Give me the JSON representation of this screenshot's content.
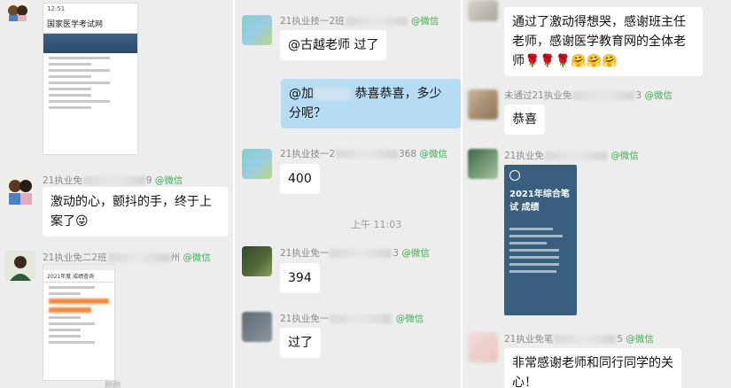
{
  "left": {
    "msg1": {
      "sender_prefix": "21执业免",
      "sender_suffix": "9",
      "source": "@微信",
      "text": "激动的心，颤抖的手，终于上案了",
      "emoji": "😜"
    },
    "msg2": {
      "sender_prefix": "21执业免二2班",
      "sender_suffix": "州",
      "source": "@微信"
    },
    "top_image_title": "国家医学考试网",
    "mini_time": "12:51",
    "shot2_title": "2021年度 成绩查询",
    "bottom_caption": "刚刚"
  },
  "center": {
    "msg1": {
      "sender_prefix": "21执业技一2班",
      "sender_suffix": "",
      "source": "@微信",
      "text": "@古越老师 过了"
    },
    "msg2": {
      "at": "@加",
      "text": "恭喜恭喜，多少分呢？"
    },
    "msg3": {
      "sender_prefix": "21执业技一2",
      "sender_suffix": "368",
      "source": "@微信",
      "text": "400"
    },
    "time": "上午 11:03",
    "msg4": {
      "sender_prefix": "21执业免一",
      "sender_suffix": "3",
      "source": "@微信",
      "text": "394"
    },
    "msg5": {
      "sender_prefix": "21执业免一",
      "sender_suffix": "",
      "source": "@微信",
      "text": "过了"
    }
  },
  "right": {
    "msg0": {
      "text": "通过了激动得想哭，感谢班主任老师，感谢医学教育网的全体老师",
      "emoji": "🌹🌹🌹🤗🤗🤗"
    },
    "msg1": {
      "sender_prefix": "未通过21执业免",
      "sender_suffix": "3",
      "source": "@微信",
      "text": "恭喜"
    },
    "msg2": {
      "sender_prefix": "21执业免",
      "sender_suffix": "",
      "source": "@微信",
      "card_title": "2021年综合笔试 成绩"
    },
    "msg3": {
      "sender_prefix": "21执业免笔",
      "sender_suffix": "5",
      "source": "@微信",
      "text": "非常感谢老师和同行同学的关心！"
    }
  },
  "colors": {
    "wechat_green": "#3fae50",
    "bubble_me": "#b5dcf3",
    "background": "#ededed"
  }
}
